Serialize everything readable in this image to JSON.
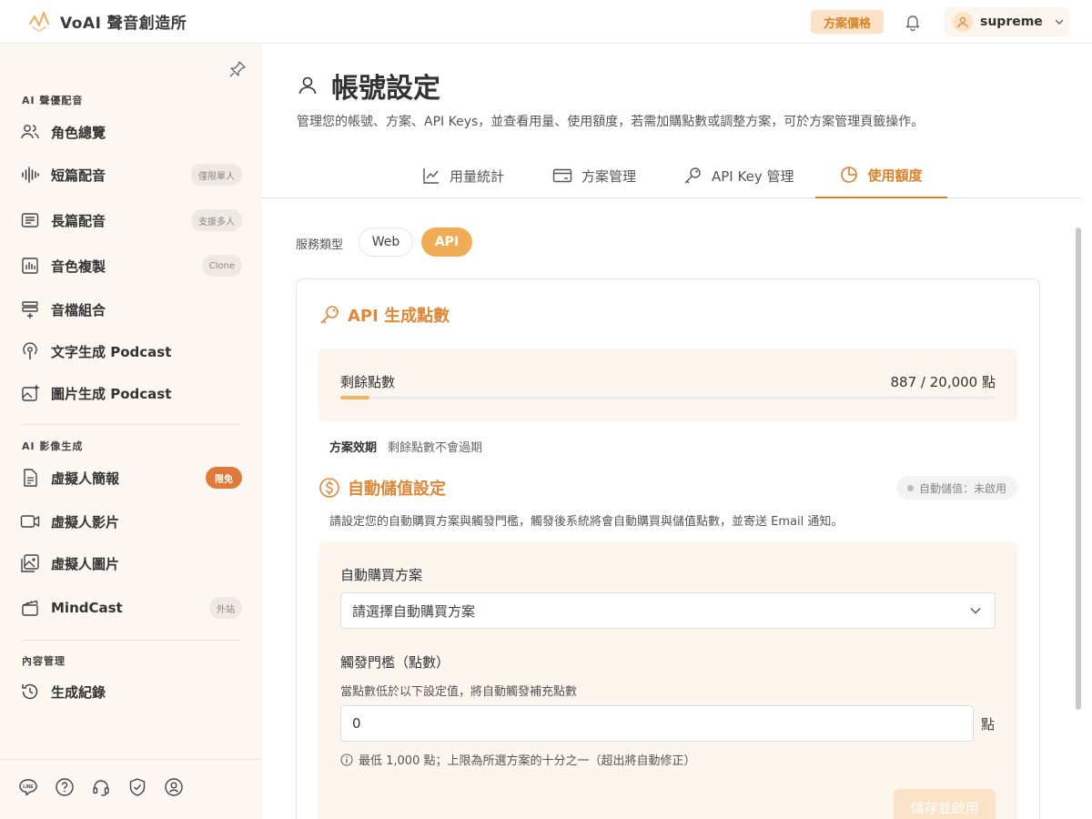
{
  "brand": {
    "name": "VoAI 聲音創造所"
  },
  "header": {
    "pricing_label": "方案價格",
    "user_name": "supreme"
  },
  "sidebar": {
    "sections": [
      {
        "title": "AI 聲優配音"
      },
      {
        "title": "AI 影像生成"
      },
      {
        "title": "內容管理"
      }
    ],
    "items": [
      {
        "label": "角色總覽",
        "icon": "users-icon",
        "badge": ""
      },
      {
        "label": "短篇配音",
        "icon": "waveform-icon",
        "badge": "僅限單人"
      },
      {
        "label": "長篇配音",
        "icon": "document-list-icon",
        "badge": "支援多人"
      },
      {
        "label": "音色複製",
        "icon": "voice-clone-icon",
        "badge": "Clone"
      },
      {
        "label": "音檔組合",
        "icon": "merge-icon",
        "badge": ""
      },
      {
        "label": "文字生成 Podcast",
        "icon": "podcast-icon",
        "badge": ""
      },
      {
        "label": "圖片生成 Podcast",
        "icon": "image-sparkle-icon",
        "badge": ""
      },
      {
        "label": "虛擬人簡報",
        "icon": "file-icon",
        "badge": "限免"
      },
      {
        "label": "虛擬人影片",
        "icon": "video-icon",
        "badge": ""
      },
      {
        "label": "虛擬人圖片",
        "icon": "image-icon",
        "badge": ""
      },
      {
        "label": "MindCast",
        "icon": "clapper-icon",
        "badge": "外站"
      },
      {
        "label": "生成紀錄",
        "icon": "history-icon",
        "badge": ""
      }
    ],
    "footer_icons": [
      "line-icon",
      "help-icon",
      "headset-icon",
      "shield-icon",
      "account-icon"
    ]
  },
  "page": {
    "title": "帳號設定",
    "description": "管理您的帳號、方案、API Keys，並查看用量、使用額度，若需加購點數或調整方案，可於方案管理頁籤操作。",
    "tabs": [
      {
        "label": "用量統計",
        "icon": "chart-icon"
      },
      {
        "label": "方案管理",
        "icon": "card-icon"
      },
      {
        "label": "API Key 管理",
        "icon": "key-icon"
      },
      {
        "label": "使用額度",
        "icon": "pie-icon",
        "active": true
      }
    ]
  },
  "service": {
    "label": "服務類型",
    "options": [
      "Web",
      "API"
    ],
    "selected": "API"
  },
  "api_points": {
    "title": "API 生成點數",
    "remaining_label": "剩餘點數",
    "remaining_value": "887 / 20,000 點",
    "used_fraction": 0.044,
    "validity_label": "方案效期",
    "validity_value": "剩餘點數不會過期"
  },
  "auto_topup": {
    "title": "自動儲值設定",
    "status": "自動儲值：未啟用",
    "description": "請設定您的自動購買方案與觸發門檻，觸發後系統將會自動購買與儲值點數，並寄送 Email 通知。",
    "plan_label": "自動購買方案",
    "plan_placeholder": "請選擇自動購買方案",
    "threshold_label": "觸發門檻（點數）",
    "threshold_help": "當點數低於以下設定值，將自動觸發補充點數",
    "threshold_value": "0",
    "threshold_unit": "點",
    "hint": "最低 1,000 點；上限為所選方案的十分之一（超出將自動修正）",
    "save_label": "儲存並啟用"
  },
  "colors": {
    "accent": "#e08838",
    "accent_light": "#fbe3c7",
    "sidebar_bg": "#fdf7f1"
  }
}
